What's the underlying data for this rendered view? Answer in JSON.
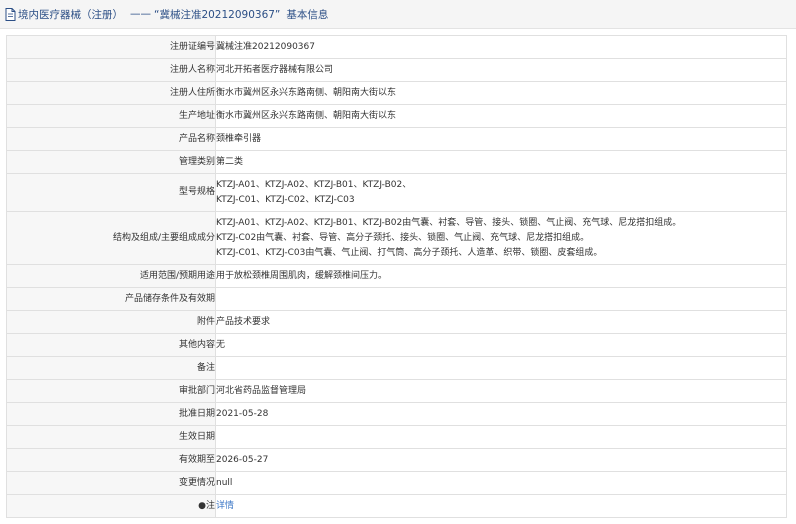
{
  "header": {
    "category": "境内医疗器械（注册）",
    "separator": "——",
    "reg_no_quoted": "“冀械注准20212090367”",
    "suffix": "基本信息"
  },
  "rows": [
    {
      "label": "注册证编号",
      "values": [
        "冀械注准20212090367"
      ]
    },
    {
      "label": "注册人名称",
      "values": [
        "河北开拓者医疗器械有限公司"
      ]
    },
    {
      "label": "注册人住所",
      "values": [
        "衡水市冀州区永兴东路南侧、朝阳南大街以东"
      ]
    },
    {
      "label": "生产地址",
      "values": [
        "衡水市冀州区永兴东路南侧、朝阳南大街以东"
      ]
    },
    {
      "label": "产品名称",
      "values": [
        "颈椎牵引器"
      ]
    },
    {
      "label": "管理类别",
      "values": [
        "第二类"
      ]
    },
    {
      "label": "型号规格",
      "values": [
        "KTZJ-A01、KTZJ-A02、KTZJ-B01、KTZJ-B02、",
        "KTZJ-C01、KTZJ-C02、KTZJ-C03"
      ]
    },
    {
      "label": "结构及组成/主要组成成分",
      "values": [
        "KTZJ-A01、KTZJ-A02、KTZJ-B01、KTZJ-B02由气囊、衬套、导管、接头、锁圈、气止阀、充气球、尼龙搭扣组成。",
        "KTZJ-C02由气囊、衬套、导管、高分子颈托、接头、锁圈、气止阀、充气球、尼龙搭扣组成。",
        "KTZJ-C01、KTZJ-C03由气囊、气止阀、打气筒、高分子颈托、人造革、织带、锁圈、皮套组成。"
      ]
    },
    {
      "label": "适用范围/预期用途",
      "values": [
        "用于放松颈椎周围肌肉，缓解颈椎间压力。"
      ]
    },
    {
      "label": "产品储存条件及有效期",
      "values": [
        ""
      ]
    },
    {
      "label": "附件",
      "values": [
        "产品技术要求"
      ]
    },
    {
      "label": "其他内容",
      "values": [
        "无"
      ]
    },
    {
      "label": "备注",
      "values": [
        ""
      ]
    },
    {
      "label": "审批部门",
      "values": [
        "河北省药品监督管理局"
      ]
    },
    {
      "label": "批准日期",
      "values": [
        "2021-05-28"
      ]
    },
    {
      "label": "生效日期",
      "values": [
        ""
      ]
    },
    {
      "label": "有效期至",
      "values": [
        "2026-05-27"
      ]
    },
    {
      "label": "变更情况",
      "values": [
        "null"
      ]
    },
    {
      "label": "●注",
      "values": [
        "详情"
      ],
      "is_link": true
    }
  ],
  "colors": {
    "link": "#3a76c6",
    "title": "#2c4f86"
  },
  "icons": {
    "title": "document-icon"
  }
}
